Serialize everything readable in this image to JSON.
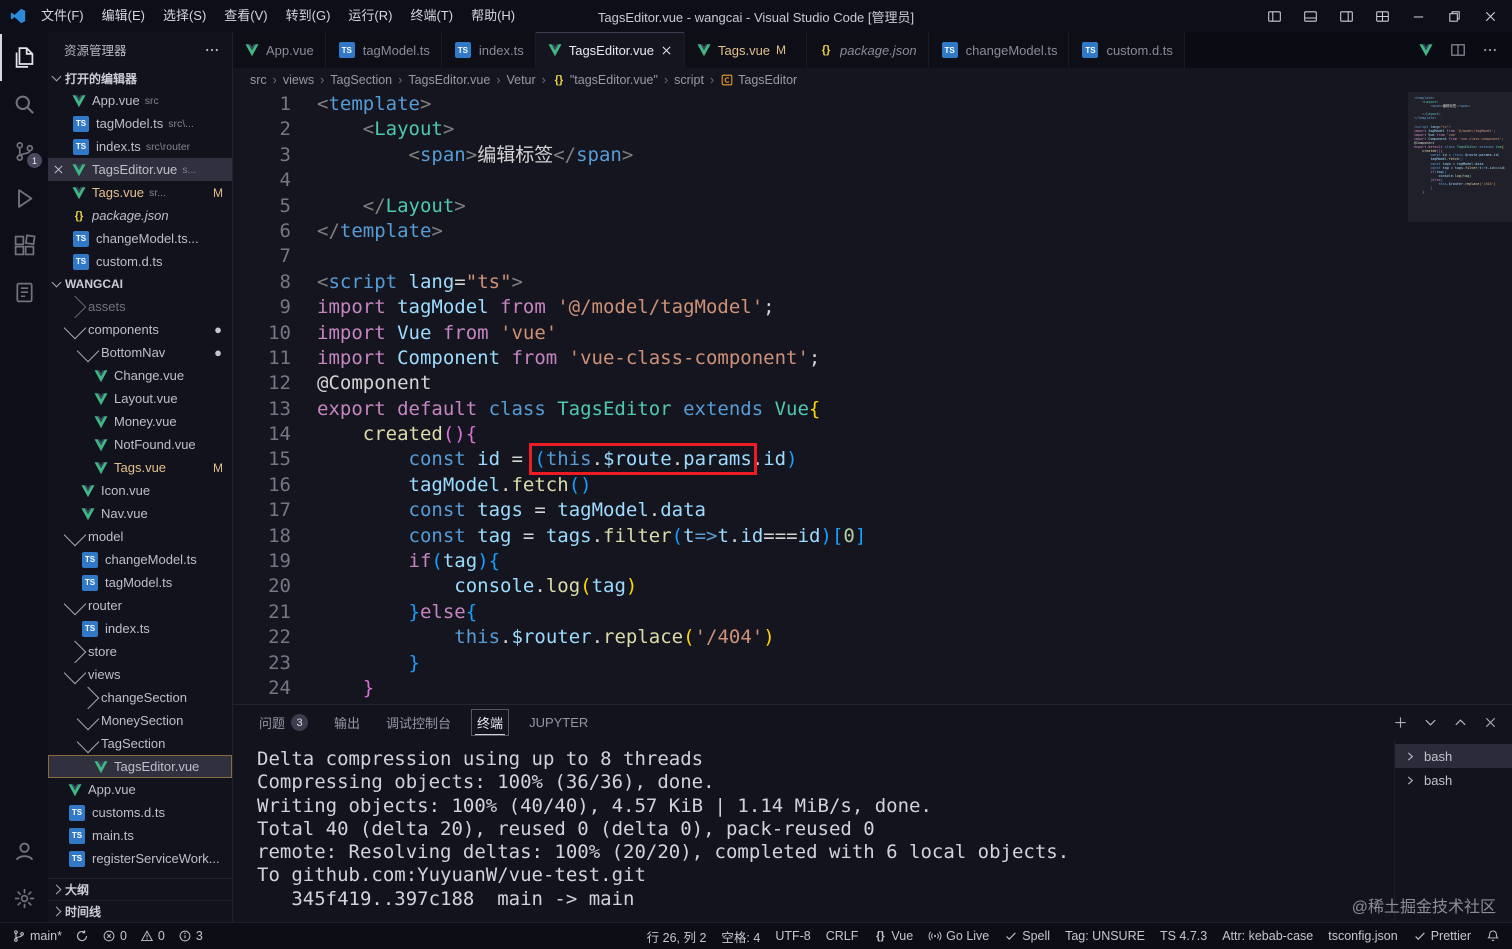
{
  "colors": {
    "annotation_box": "#ec1c24",
    "modified": "#e2c08d",
    "vue_green": "#41b883",
    "ts_blue": "#3178c6"
  },
  "titlebar": {
    "menus": [
      "文件(F)",
      "编辑(E)",
      "选择(S)",
      "查看(V)",
      "转到(G)",
      "运行(R)",
      "终端(T)",
      "帮助(H)"
    ],
    "title": "TagsEditor.vue - wangcai - Visual Studio Code [管理员]",
    "controls": [
      "layout-sidebar",
      "layout-panel",
      "layout-sidebar-right",
      "layout-grid",
      "minimize",
      "restore",
      "close"
    ]
  },
  "activity": {
    "top": [
      {
        "icon": "files",
        "active": true
      },
      {
        "icon": "search"
      },
      {
        "icon": "source-control",
        "badge": "1"
      },
      {
        "icon": "debug"
      },
      {
        "icon": "extensions"
      },
      {
        "icon": "notebook"
      }
    ],
    "bottom": [
      {
        "icon": "account"
      },
      {
        "icon": "settings"
      }
    ]
  },
  "sidebar": {
    "header": "资源管理器",
    "sections": {
      "open_editors": "打开的编辑器",
      "project": "WANGCAI",
      "outline": "大纲",
      "timeline": "时间线"
    },
    "open_editors": [
      {
        "icon": "vue",
        "name": "App.vue",
        "detail": "src"
      },
      {
        "icon": "ts",
        "name": "tagModel.ts",
        "detail": "src\\..."
      },
      {
        "icon": "ts",
        "name": "index.ts",
        "detail": "src\\router"
      },
      {
        "icon": "vue",
        "name": "TagsEditor.vue",
        "detail": "s...",
        "active": true
      },
      {
        "icon": "vue",
        "name": "Tags.vue",
        "detail": "sr...",
        "badge": "M",
        "mod": true
      },
      {
        "icon": "json",
        "name": "package.json",
        "italic": true
      },
      {
        "icon": "ts",
        "name": "changeModel.ts..."
      },
      {
        "icon": "ts",
        "name": "custom.d.ts"
      }
    ],
    "tree": [
      {
        "i": 1,
        "arrow": "right",
        "name": "assets",
        "dim": true
      },
      {
        "i": 1,
        "arrow": "down",
        "name": "components",
        "dot": true
      },
      {
        "i": 2,
        "arrow": "down",
        "name": "BottomNav",
        "dot": true
      },
      {
        "i": 3,
        "icon": "vue",
        "name": "Change.vue"
      },
      {
        "i": 3,
        "icon": "vue",
        "name": "Layout.vue"
      },
      {
        "i": 3,
        "icon": "vue",
        "name": "Money.vue"
      },
      {
        "i": 3,
        "icon": "vue",
        "name": "NotFound.vue"
      },
      {
        "i": 3,
        "icon": "vue",
        "name": "Tags.vue",
        "badge": "M",
        "mod": true
      },
      {
        "i": 2,
        "icon": "vue",
        "name": "Icon.vue"
      },
      {
        "i": 2,
        "icon": "vue",
        "name": "Nav.vue"
      },
      {
        "i": 1,
        "arrow": "down",
        "name": "model"
      },
      {
        "i": 2,
        "icon": "ts",
        "name": "changeModel.ts"
      },
      {
        "i": 2,
        "icon": "ts",
        "name": "tagModel.ts"
      },
      {
        "i": 1,
        "arrow": "down",
        "name": "router"
      },
      {
        "i": 2,
        "icon": "ts",
        "name": "index.ts"
      },
      {
        "i": 1,
        "arrow": "right",
        "name": "store"
      },
      {
        "i": 1,
        "arrow": "down",
        "name": "views"
      },
      {
        "i": 2,
        "arrow": "right",
        "name": "changeSection"
      },
      {
        "i": 2,
        "arrow": "down",
        "name": "MoneySection"
      },
      {
        "i": 2,
        "arrow": "down",
        "name": "TagSection"
      },
      {
        "i": 3,
        "icon": "vue",
        "name": "TagsEditor.vue",
        "selected": true
      },
      {
        "i": 1,
        "icon": "vue",
        "name": "App.vue"
      },
      {
        "i": 1,
        "icon": "ts",
        "name": "customs.d.ts"
      },
      {
        "i": 1,
        "icon": "ts",
        "name": "main.ts"
      },
      {
        "i": 1,
        "icon": "ts",
        "name": "registerServiceWork..."
      }
    ]
  },
  "tabs": [
    {
      "icon": "vue",
      "name": "App.vue"
    },
    {
      "icon": "ts",
      "name": "tagModel.ts"
    },
    {
      "icon": "ts",
      "name": "index.ts"
    },
    {
      "icon": "vue",
      "name": "TagsEditor.vue",
      "active": true
    },
    {
      "icon": "vue",
      "name": "Tags.vue",
      "badge": "M",
      "mod": true
    },
    {
      "icon": "json",
      "name": "package.json",
      "italic": true
    },
    {
      "icon": "ts",
      "name": "changeModel.ts"
    },
    {
      "icon": "ts",
      "name": "custom.d.ts"
    }
  ],
  "tab_actions": [
    "vue",
    "split",
    "more"
  ],
  "breadcrumbs": [
    {
      "label": "src"
    },
    {
      "label": "views"
    },
    {
      "label": "TagSection"
    },
    {
      "label": "TagsEditor.vue"
    },
    {
      "label": "Vetur"
    },
    {
      "icon": "json",
      "label": "\"tagsEditor.vue\""
    },
    {
      "label": "script"
    },
    {
      "icon": "symbol-class",
      "label": "TagsEditor"
    }
  ],
  "editor": {
    "lines": [
      {
        "n": 1,
        "t": [
          [
            "<",
            "p"
          ],
          [
            "template",
            "tag"
          ],
          [
            ">",
            "p"
          ]
        ]
      },
      {
        "n": 2,
        "t": [
          [
            "    ",
            "w"
          ],
          [
            "<",
            "p"
          ],
          [
            "Layout",
            "cls"
          ],
          [
            ">",
            "p"
          ]
        ]
      },
      {
        "n": 3,
        "t": [
          [
            "        ",
            "w"
          ],
          [
            "<",
            "p"
          ],
          [
            "span",
            "tag"
          ],
          [
            ">",
            "p"
          ],
          [
            "编辑标签",
            "w"
          ],
          [
            "</",
            "p"
          ],
          [
            "span",
            "tag"
          ],
          [
            ">",
            "p"
          ]
        ]
      },
      {
        "n": 4,
        "t": []
      },
      {
        "n": 5,
        "t": [
          [
            "    ",
            "w"
          ],
          [
            "</",
            "p"
          ],
          [
            "Layout",
            "cls"
          ],
          [
            ">",
            "p"
          ]
        ]
      },
      {
        "n": 6,
        "t": [
          [
            "</",
            "p"
          ],
          [
            "template",
            "tag"
          ],
          [
            ">",
            "p"
          ]
        ]
      },
      {
        "n": 7,
        "t": []
      },
      {
        "n": 8,
        "t": [
          [
            "<",
            "p"
          ],
          [
            "script ",
            "tag"
          ],
          [
            "lang",
            "v"
          ],
          [
            "=",
            "w"
          ],
          [
            "\"ts\"",
            "s"
          ],
          [
            ">",
            "p"
          ]
        ]
      },
      {
        "n": 9,
        "t": [
          [
            "import ",
            "k"
          ],
          [
            "tagModel",
            "v"
          ],
          [
            " from ",
            "k"
          ],
          [
            "'@/model/tagModel'",
            "s"
          ],
          [
            ";",
            "w"
          ]
        ]
      },
      {
        "n": 10,
        "t": [
          [
            "import ",
            "k"
          ],
          [
            "Vue",
            "v"
          ],
          [
            " from ",
            "k"
          ],
          [
            "'vue'",
            "s"
          ]
        ]
      },
      {
        "n": 11,
        "t": [
          [
            "import ",
            "k"
          ],
          [
            "Component",
            "v"
          ],
          [
            " from ",
            "k"
          ],
          [
            "'vue-class-component'",
            "s"
          ],
          [
            ";",
            "w"
          ]
        ]
      },
      {
        "n": 12,
        "t": [
          [
            "@Component",
            "w"
          ]
        ]
      },
      {
        "n": 13,
        "t": [
          [
            "export default ",
            "k"
          ],
          [
            "class ",
            "kb"
          ],
          [
            "TagsEditor ",
            "cls"
          ],
          [
            "extends ",
            "kb"
          ],
          [
            "Vue",
            "cls"
          ],
          [
            "{",
            "bg"
          ]
        ]
      },
      {
        "n": 14,
        "t": [
          [
            "    ",
            "w"
          ],
          [
            "created",
            "fn"
          ],
          [
            "(",
            "bp"
          ],
          [
            ")",
            "bp"
          ],
          [
            "{",
            "bp"
          ]
        ]
      },
      {
        "n": 15,
        "t": [
          [
            "        ",
            "w"
          ],
          [
            "const ",
            "kb"
          ],
          [
            "id",
            "v"
          ],
          [
            " = ",
            "w"
          ],
          [
            "(",
            "bb",
            1
          ],
          [
            "this",
            "kb",
            1
          ],
          [
            ".",
            "w",
            1
          ],
          [
            "$route",
            "v",
            1
          ],
          [
            ".",
            "w",
            1
          ],
          [
            "params",
            "v",
            1
          ],
          [
            ".",
            "w"
          ],
          [
            "id",
            "v"
          ],
          [
            ")",
            "bb"
          ]
        ]
      },
      {
        "n": 16,
        "t": [
          [
            "        ",
            "w"
          ],
          [
            "tagModel",
            "v"
          ],
          [
            ".",
            "w"
          ],
          [
            "fetch",
            "fn"
          ],
          [
            "(",
            "bb"
          ],
          [
            ")",
            "bb"
          ]
        ]
      },
      {
        "n": 17,
        "t": [
          [
            "        ",
            "w"
          ],
          [
            "const ",
            "kb"
          ],
          [
            "tags",
            "v"
          ],
          [
            " = ",
            "w"
          ],
          [
            "tagModel",
            "v"
          ],
          [
            ".",
            "w"
          ],
          [
            "data",
            "v"
          ]
        ]
      },
      {
        "n": 18,
        "t": [
          [
            "        ",
            "w"
          ],
          [
            "const ",
            "kb"
          ],
          [
            "tag",
            "v"
          ],
          [
            " = ",
            "w"
          ],
          [
            "tags",
            "v"
          ],
          [
            ".",
            "w"
          ],
          [
            "filter",
            "fn"
          ],
          [
            "(",
            "bb"
          ],
          [
            "t",
            "v"
          ],
          [
            "=>",
            "kb"
          ],
          [
            "t",
            "v"
          ],
          [
            ".",
            "w"
          ],
          [
            "id",
            "v"
          ],
          [
            "===",
            "w"
          ],
          [
            "id",
            "v"
          ],
          [
            ")",
            "bb"
          ],
          [
            "[",
            "bb"
          ],
          [
            "0",
            "n"
          ],
          [
            "]",
            "bb"
          ]
        ]
      },
      {
        "n": 19,
        "t": [
          [
            "        ",
            "w"
          ],
          [
            "if",
            "k"
          ],
          [
            "(",
            "bb"
          ],
          [
            "tag",
            "v"
          ],
          [
            ")",
            "bb"
          ],
          [
            "{",
            "bb"
          ]
        ]
      },
      {
        "n": 20,
        "t": [
          [
            "            ",
            "w"
          ],
          [
            "console",
            "v"
          ],
          [
            ".",
            "w"
          ],
          [
            "log",
            "fn"
          ],
          [
            "(",
            "bg"
          ],
          [
            "tag",
            "v"
          ],
          [
            ")",
            "bg"
          ]
        ]
      },
      {
        "n": 21,
        "t": [
          [
            "        ",
            "w"
          ],
          [
            "}",
            "bb"
          ],
          [
            "else",
            "k"
          ],
          [
            "{",
            "bb"
          ]
        ]
      },
      {
        "n": 22,
        "t": [
          [
            "            ",
            "w"
          ],
          [
            "this",
            "kb"
          ],
          [
            ".",
            "w"
          ],
          [
            "$router",
            "v"
          ],
          [
            ".",
            "w"
          ],
          [
            "replace",
            "fn"
          ],
          [
            "(",
            "bg"
          ],
          [
            "'/404'",
            "s"
          ],
          [
            ")",
            "bg"
          ]
        ]
      },
      {
        "n": 23,
        "t": [
          [
            "        ",
            "w"
          ],
          [
            "}",
            "bb"
          ]
        ]
      },
      {
        "n": 24,
        "t": [
          [
            "    ",
            "w"
          ],
          [
            "}",
            "bp"
          ]
        ]
      }
    ]
  },
  "panel": {
    "tabs": [
      {
        "label": "问题",
        "badge": "3"
      },
      {
        "label": "输出"
      },
      {
        "label": "调试控制台"
      },
      {
        "label": "终端",
        "active": true,
        "focus": true
      },
      {
        "label": "JUPYTER"
      }
    ],
    "actions": [
      "plus",
      "dropdown-chevron",
      "maximize-chevron",
      "close"
    ],
    "terminal_lines": [
      "Delta compression using up to 8 threads",
      "Compressing objects: 100% (36/36), done.",
      "Writing objects: 100% (40/40), 4.57 KiB | 1.14 MiB/s, done.",
      "Total 40 (delta 20), reused 0 (delta 0), pack-reused 0",
      "remote: Resolving deltas: 100% (20/20), completed with 6 local objects.",
      "To github.com:YuyuanW/vue-test.git",
      "   345f419..397c188  main -> main"
    ],
    "terminals": [
      {
        "label": "bash"
      },
      {
        "label": "bash"
      }
    ]
  },
  "status": {
    "left": [
      {
        "icon": "branch",
        "label": "main*"
      },
      {
        "icon": "sync"
      },
      {
        "icon": "error",
        "label": "0"
      },
      {
        "icon": "warning",
        "label": "0"
      },
      {
        "icon": "info",
        "label": "3"
      }
    ],
    "right": [
      {
        "label": "行 26, 列 2"
      },
      {
        "label": "空格: 4"
      },
      {
        "label": "UTF-8"
      },
      {
        "label": "CRLF"
      },
      {
        "icon": "braces",
        "label": "Vue"
      },
      {
        "icon": "broadcast",
        "label": "Go Live"
      },
      {
        "icon": "check",
        "label": "Spell"
      },
      {
        "label": "Tag: UNSURE"
      },
      {
        "label": "TS 4.7.3"
      },
      {
        "label": "Attr: kebab-case"
      },
      {
        "label": "tsconfig.json"
      },
      {
        "icon": "check",
        "label": "Prettier"
      },
      {
        "icon": "bell"
      }
    ]
  },
  "watermark": "@稀土掘金技术社区"
}
